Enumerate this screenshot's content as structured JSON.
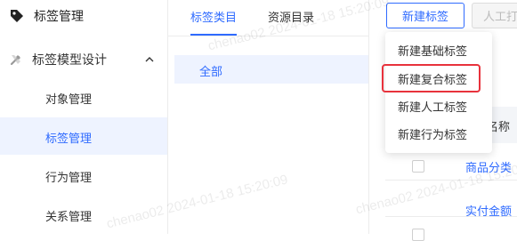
{
  "sidebar": {
    "brand_label": "标签管理",
    "group_label": "标签模型设计",
    "items": [
      {
        "label": "对象管理"
      },
      {
        "label": "标签管理"
      },
      {
        "label": "行为管理"
      },
      {
        "label": "关系管理"
      }
    ]
  },
  "tabs": [
    {
      "label": "标签类目"
    },
    {
      "label": "资源目录"
    }
  ],
  "category_filter": {
    "label": "全部"
  },
  "toolbar": {
    "new_tag_label": "新建标签",
    "manual_label": "人工打"
  },
  "dropdown": {
    "items": [
      {
        "label": "新建基础标签"
      },
      {
        "label": "新建复合标签"
      },
      {
        "label": "新建人工标签"
      },
      {
        "label": "新建行为标签"
      }
    ]
  },
  "table": {
    "header_name": "签名称",
    "rows": [
      {
        "name": "商品分类"
      },
      {
        "name": "实付金额"
      }
    ]
  },
  "watermark": "chenao02 2024-01-18 15:20:09",
  "colors": {
    "accent": "#2f6bff",
    "highlight": "#e8323c",
    "active_bg": "#eef3ff"
  },
  "icons": {
    "brand": "tag-icon",
    "group": "model-tools-icon",
    "chevron": "chevron-up-icon"
  }
}
